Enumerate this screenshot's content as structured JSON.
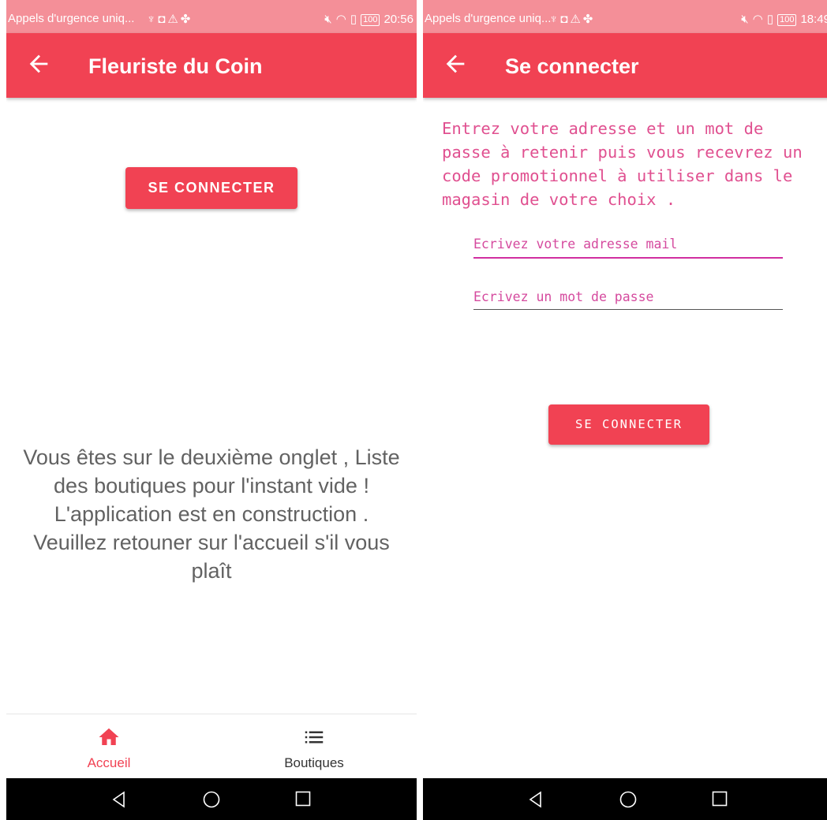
{
  "colors": {
    "primary": "#f14253",
    "status_bar": "#f48f98",
    "accent_text": "#e05090",
    "body_text": "#626262",
    "nav_inactive": "#333333"
  },
  "left_screen": {
    "status_bar": {
      "carrier": "Appels d'urgence uniq...",
      "left_icons": [
        "usb-icon",
        "shield-app-icon",
        "warning-icon",
        "fan-icon"
      ],
      "right_icons": [
        "mute-icon",
        "wifi-icon",
        "sim-icon"
      ],
      "battery": "100",
      "time": "20:56"
    },
    "app_bar": {
      "back_icon": "arrow-back-icon",
      "title": "Fleuriste du Coin"
    },
    "connect_button": "SE CONNECTER",
    "message": "Vous êtes sur le deuxième onglet , Liste des boutiques pour l'instant vide ! L'application est en construction . Veuillez retouner sur l'accueil s'il vous plaît",
    "bottom_nav": [
      {
        "label": "Accueil",
        "icon": "home-icon",
        "active": true
      },
      {
        "label": "Boutiques",
        "icon": "list-icon",
        "active": false
      }
    ]
  },
  "right_screen": {
    "status_bar": {
      "carrier": "Appels d'urgence uniq...",
      "left_icons": [
        "usb-icon",
        "shield-app-icon",
        "warning-icon",
        "fan-icon"
      ],
      "right_icons": [
        "mute-icon",
        "wifi-icon",
        "sim-icon"
      ],
      "battery": "100",
      "time": "18:49"
    },
    "app_bar": {
      "back_icon": "arrow-back-icon",
      "title": "Se connecter"
    },
    "description": "Entrez votre adresse et un mot de passe à retenir puis vous recevrez un code promotionnel à utiliser dans le magasin de votre choix .",
    "email_placeholder": "Ecrivez votre adresse mail",
    "password_placeholder": "Ecrivez un mot de passe",
    "connect_button": "SE CONNECTER"
  },
  "system_nav": [
    "back-triangle-icon",
    "home-circle-icon",
    "recents-square-icon"
  ]
}
